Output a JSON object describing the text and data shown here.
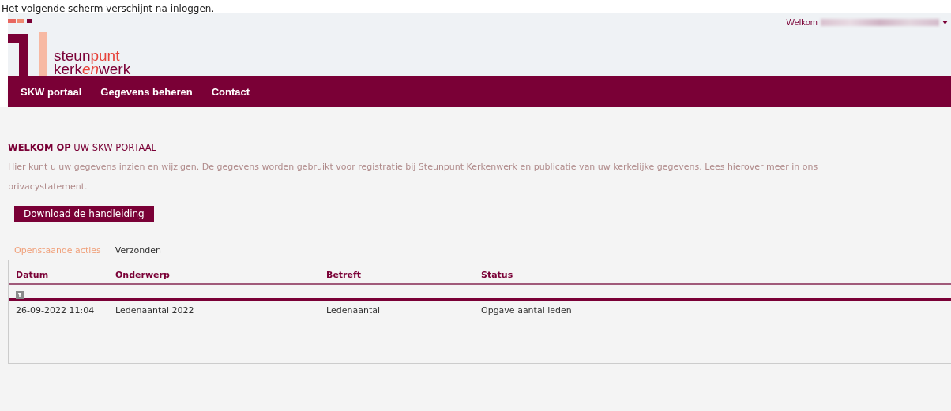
{
  "caption": "Het volgende scherm verschijnt na inloggen.",
  "header": {
    "welcome": "Welkom",
    "logo": {
      "line_1_a": "steun",
      "line_1_b": "punt",
      "line_2_a": "kerk",
      "line_2_b": "en",
      "line_2_c": "werk"
    }
  },
  "nav": [
    {
      "label": "SKW portaal"
    },
    {
      "label": "Gegevens beheren"
    },
    {
      "label": "Contact"
    }
  ],
  "intro": {
    "title_bold": "WELKOM OP",
    "title_rest": "UW SKW-PORTAAL",
    "text": "Hier kunt u uw gegevens inzien en wijzigen. De gegevens worden gebruikt voor registratie bij Steunpunt Kerkenwerk en publicatie van uw kerkelijke gegevens. Lees hierover meer in ons privacystatement.",
    "button": "Download de handleiding"
  },
  "tabs": [
    {
      "label": "Openstaande acties",
      "selected": true
    },
    {
      "label": "Verzonden",
      "selected": false
    }
  ],
  "table": {
    "columns": [
      "Datum",
      "Onderwerp",
      "Betreft",
      "Status"
    ],
    "rows": [
      [
        "26-09-2022 11:04",
        "Ledenaantal 2022",
        "Ledenaantal",
        "Opgave aantal leden"
      ]
    ]
  }
}
